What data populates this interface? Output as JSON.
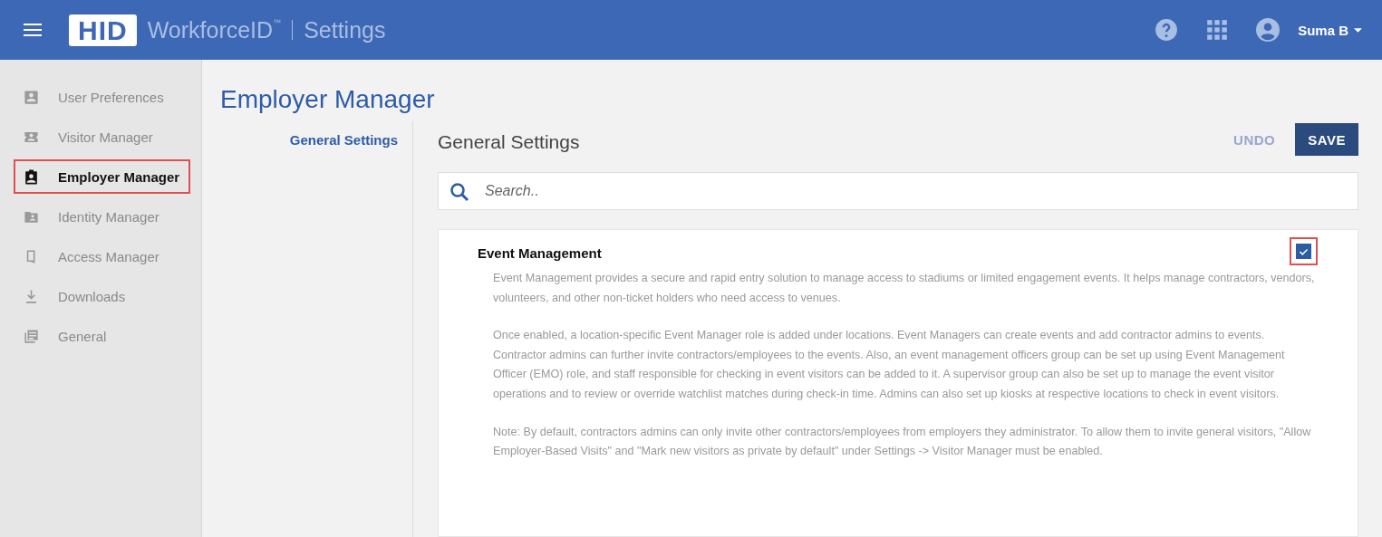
{
  "header": {
    "logo": "HID",
    "product": "WorkforceID",
    "trademark": "™",
    "section": "Settings",
    "user": "Suma B"
  },
  "sidebar": {
    "items": [
      {
        "label": "User Preferences",
        "selected": false,
        "highlighted": false
      },
      {
        "label": "Visitor Manager",
        "selected": false,
        "highlighted": false
      },
      {
        "label": "Employer Manager",
        "selected": true,
        "highlighted": true
      },
      {
        "label": "Identity Manager",
        "selected": false,
        "highlighted": false
      },
      {
        "label": "Access Manager",
        "selected": false,
        "highlighted": false
      },
      {
        "label": "Downloads",
        "selected": false,
        "highlighted": false
      },
      {
        "label": "General",
        "selected": false,
        "highlighted": false
      }
    ]
  },
  "page_title": "Employer Manager",
  "subnav": [
    {
      "label": "General Settings",
      "selected": true
    }
  ],
  "panel": {
    "title": "General Settings",
    "undo": "UNDO",
    "save": "SAVE",
    "search_placeholder": "Search..",
    "settings": [
      {
        "title": "Event Management",
        "checked": true,
        "highlighted": true,
        "paragraphs": [
          "Event Management provides a secure and rapid entry solution to manage access to stadiums or limited engagement events. It helps manage contractors, vendors, volunteers, and other non-ticket holders who need access to venues.",
          "Once enabled, a location-specific Event Manager role is added under locations. Event Managers can create events and add contractor admins to events. Contractor admins can further invite contractors/employees to the events. Also, an event management officers group can be set up using Event Management Officer (EMO) role, and staff responsible for checking in event visitors can be added to it. A supervisor group can also be set up to manage the event visitor operations and to review or override watchlist matches during check-in time. Admins can also set up kiosks at respective locations to check in event visitors.",
          "Note: By default, contractors admins can only invite other contractors/employees from employers they administrator. To allow them to invite general visitors, \"Allow Employer-Based Visits\" and \"Mark new visitors as private by default\" under Settings -> Visitor Manager must be enabled."
        ]
      }
    ]
  }
}
